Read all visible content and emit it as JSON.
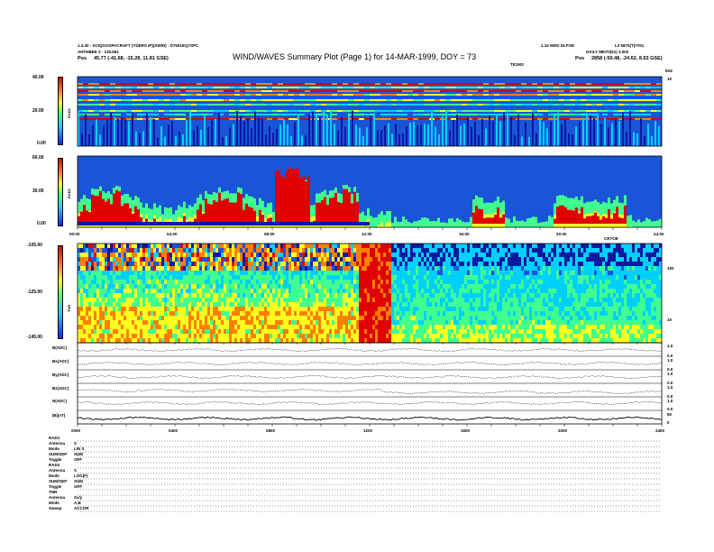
{
  "header": {
    "title": "WIND/WAVES Summary Plot (Page 1) for 14-MAR-1999, DOY = 73",
    "left_line1": "1.3.30 - SCIQGOSPACRAFT (YDERS IP)(SWRI) - D7501EQ7SPC",
    "left_line2": "ANTHBEE 3  -  135.651",
    "left_pos_label": "Pos",
    "left_pos_value": "45.77 (-41.68, -15.28, 11.81 GSE)",
    "right_line1": "1.10 WED  DLFOE",
    "right_line2": "DAILY  98070(51) 3.002",
    "right_pos_label": "Pos",
    "right_pos_value": "2858 (-50.48, -24.62, 8.53 GSE)",
    "right_top_code": "L3 5870(T)##51",
    "mid_tag": "TE1MS",
    "corner_tag": "kHz"
  },
  "colors": {
    "background_blue": "#1a55d8",
    "deep_blue": "#0a1aa0",
    "cyan": "#00d0ff",
    "green": "#40ff90",
    "yellow": "#ffff20",
    "orange": "#ff8000",
    "red": "#e00000"
  },
  "chart_data": [
    {
      "type": "heatmap",
      "panel": "RAD2",
      "colorbar_ticks": [
        "40.00",
        "20.00",
        "0.00"
      ],
      "ylabel": "RAD2",
      "right_axis_label": "10",
      "x_range_hours": [
        0,
        24
      ]
    },
    {
      "type": "heatmap",
      "panel": "RAD1",
      "colorbar_ticks": [
        "60.00",
        "30.00",
        "0.00"
      ],
      "ylabel": "RAD1",
      "x_range_hours": [
        0,
        24
      ],
      "x_ticks": [
        "00:00",
        "04:00",
        "08:00",
        "12:00",
        "16:00",
        "20:00",
        "24:00"
      ],
      "x_tag": "CRYOE"
    },
    {
      "type": "heatmap",
      "panel": "TNR",
      "colorbar_ticks": [
        "-105.00",
        "-125.00",
        "-145.00"
      ],
      "ylabel": "TNR",
      "right_ticks": [
        "100",
        "10"
      ],
      "x_range_hours": [
        0,
        24
      ]
    },
    {
      "type": "line",
      "panel": "magnetic",
      "series": [
        {
          "name": "B(ADC)",
          "axis": [
            "1.0",
            "0.0"
          ]
        },
        {
          "name": "Bx(ADC)",
          "axis": [
            "1.0",
            "0.0"
          ]
        },
        {
          "name": "By(ADC)",
          "axis": [
            "1.0",
            "0.0"
          ]
        },
        {
          "name": "Bz(ADC)",
          "axis": [
            "1.0",
            "0.0"
          ]
        },
        {
          "name": "N(ADC)",
          "axis": [
            "1.0",
            "0.0"
          ]
        },
        {
          "name": "|B|(nT)",
          "axis": [
            "50",
            "0"
          ]
        }
      ],
      "x_ticks": [
        "0000",
        "0400",
        "0800",
        "1200",
        "1600",
        "2000",
        "2400"
      ]
    }
  ],
  "params": {
    "blocks": [
      {
        "head": "RAD1",
        "rows": [
          [
            "Antenna",
            "S"
          ],
          [
            "Mode",
            "LIN S"
          ],
          [
            "SUM/SEP",
            "SUM"
          ],
          [
            "Toggle",
            "OFF"
          ]
        ]
      },
      {
        "head": "RAD2",
        "rows": [
          [
            "Antenna",
            "S"
          ],
          [
            "Mode",
            "LOG(F)"
          ],
          [
            "SUM/SEP",
            "SUM"
          ],
          [
            "Toggle",
            "OFF"
          ]
        ]
      },
      {
        "head": "TNR",
        "rows": [
          [
            "Antenna",
            "Sx/y"
          ],
          [
            "Mode",
            "A,B"
          ],
          [
            "Sweep",
            "ACCOR"
          ]
        ]
      }
    ]
  }
}
